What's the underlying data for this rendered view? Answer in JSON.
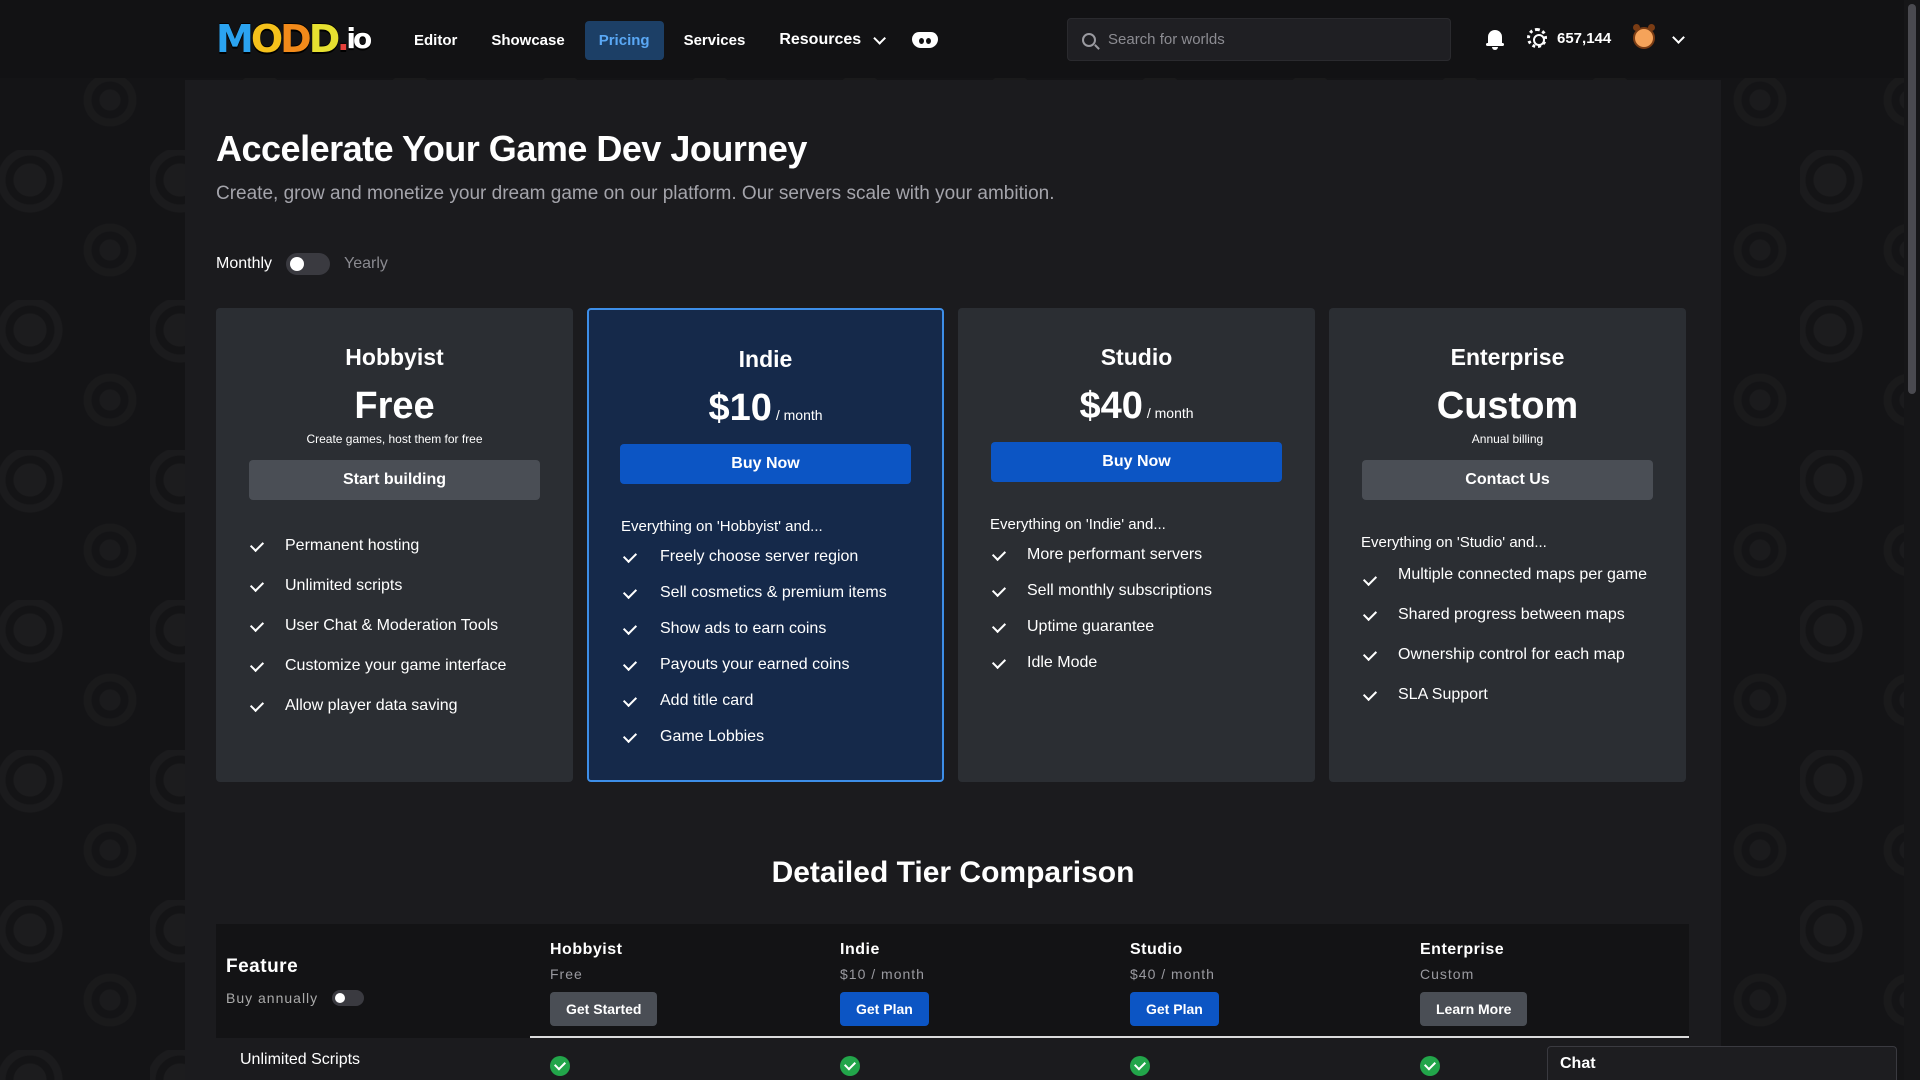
{
  "nav": {
    "logo_text": "MODD.io",
    "links": [
      "Editor",
      "Showcase",
      "Pricing",
      "Services"
    ],
    "resources_label": "Resources",
    "search_placeholder": "Search for worlds",
    "coins": "657,144"
  },
  "hero": {
    "title": "Accelerate Your Game Dev Journey",
    "subtitle": "Create, grow and monetize your dream game on our platform. Our servers scale with your ambition.",
    "monthly_label": "Monthly",
    "yearly_label": "Yearly"
  },
  "plans": [
    {
      "name": "Hobbyist",
      "price": "Free",
      "note": "Create games, host them for free",
      "button": "Start building",
      "features": [
        "Permanent hosting",
        "Unlimited scripts",
        "User Chat & Moderation Tools",
        "Customize your game interface",
        "Allow player data saving"
      ]
    },
    {
      "name": "Indie",
      "price": "$10",
      "per": "/ month",
      "button": "Buy Now",
      "intro": "Everything on 'Hobbyist' and...",
      "features": [
        "Freely choose server region",
        "Sell cosmetics & premium items",
        "Show ads to earn coins",
        "Payouts your earned coins",
        "Add title card",
        "Game Lobbies"
      ]
    },
    {
      "name": "Studio",
      "price": "$40",
      "per": "/ month",
      "button": "Buy Now",
      "intro": "Everything on 'Indie' and...",
      "features": [
        "More performant servers",
        "Sell monthly subscriptions",
        "Uptime guarantee",
        "Idle Mode"
      ]
    },
    {
      "name": "Enterprise",
      "price": "Custom",
      "note": "Annual billing",
      "button": "Contact Us",
      "intro": "Everything on 'Studio' and...",
      "features": [
        "Multiple connected maps per game",
        "Shared progress between maps",
        "Ownership control for each map",
        "SLA Support"
      ]
    }
  ],
  "comparison": {
    "title": "Detailed Tier Comparison",
    "feature_label": "Feature",
    "buy_annually": "Buy annually",
    "columns": [
      {
        "name": "Hobbyist",
        "sub": "Free",
        "button": "Get Started"
      },
      {
        "name": "Indie",
        "sub": "$10 / month",
        "button": "Get Plan"
      },
      {
        "name": "Studio",
        "sub": "$40 / month",
        "button": "Get Plan"
      },
      {
        "name": "Enterprise",
        "sub": "Custom",
        "button": "Learn More"
      }
    ],
    "rows": [
      {
        "label": "Unlimited Scripts",
        "values": [
          true,
          true,
          true,
          true
        ]
      }
    ]
  },
  "chat_label": "Chat",
  "colors": {
    "accent": "#0c55c4",
    "featured_bg": "#15294a",
    "featured_border": "#3d8ee8",
    "check_green": "#22a54a"
  }
}
